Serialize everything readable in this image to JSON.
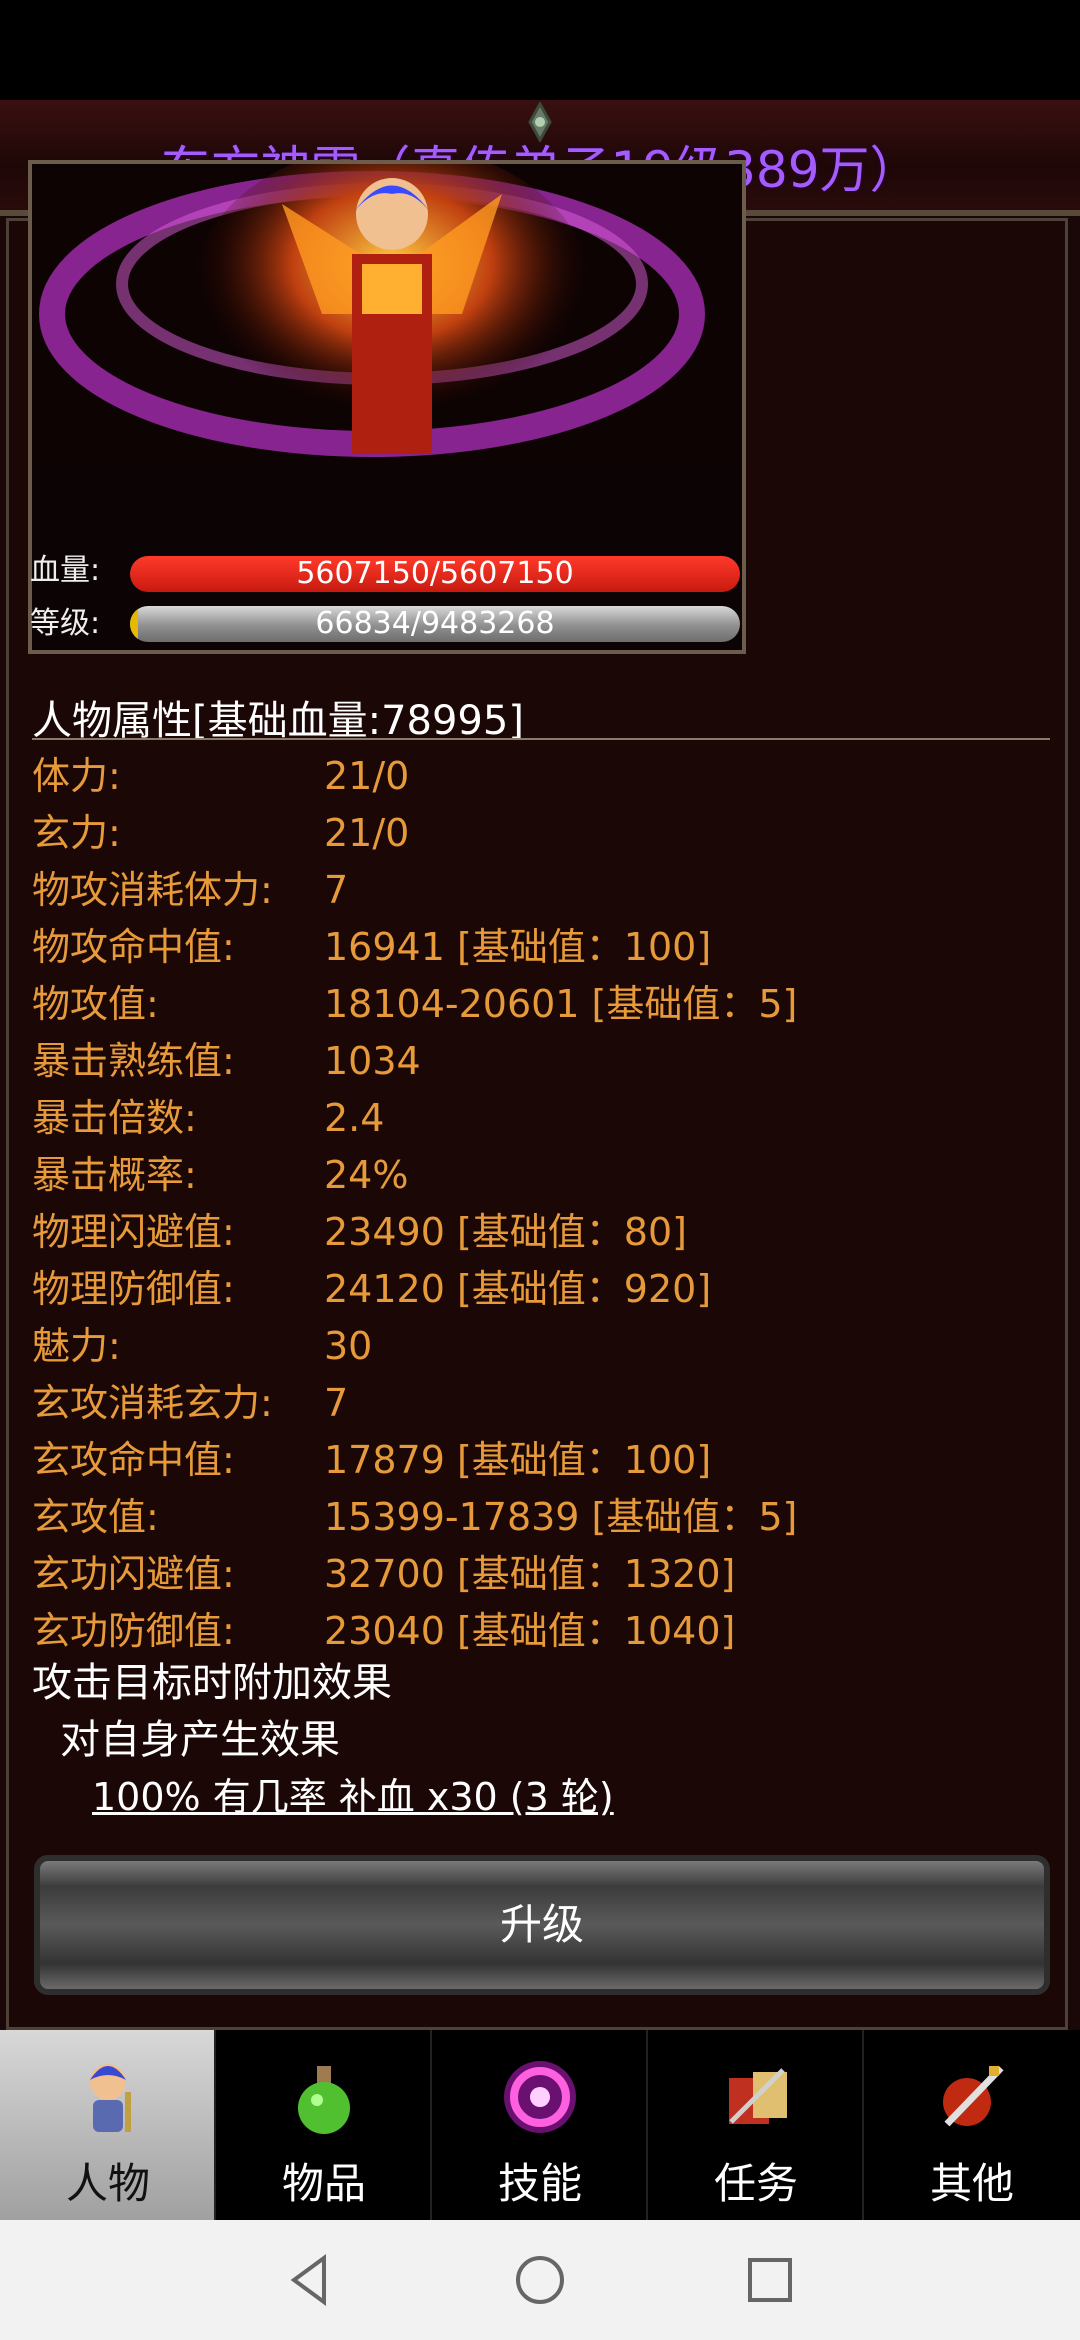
{
  "header": {
    "title": "东方神雪（真传弟子19级389万）"
  },
  "portrait": {
    "hp_label": "血量:",
    "hp_value": "5607150/5607150",
    "level_label": "等级:",
    "level_value": "66834/9483268",
    "xp_fraction": 0.007
  },
  "attributes": {
    "title": "人物属性[基础血量:78995]",
    "rows": [
      {
        "label": "体力:",
        "value": "21/0"
      },
      {
        "label": "玄力:",
        "value": "21/0"
      },
      {
        "label": "物攻消耗体力:",
        "value": "7"
      },
      {
        "label": "物攻命中值:",
        "value": "16941 [基础值：100]"
      },
      {
        "label": "物攻值:",
        "value": "18104-20601 [基础值：5]"
      },
      {
        "label": "暴击熟练值:",
        "value": "1034"
      },
      {
        "label": "暴击倍数:",
        "value": "2.4"
      },
      {
        "label": "暴击概率:",
        "value": "24%"
      },
      {
        "label": "物理闪避值:",
        "value": "23490 [基础值：80]"
      },
      {
        "label": "物理防御值:",
        "value": "24120 [基础值：920]"
      },
      {
        "label": "魅力:",
        "value": "30"
      },
      {
        "label": "玄攻消耗玄力:",
        "value": "7"
      },
      {
        "label": "玄攻命中值:",
        "value": "17879 [基础值：100]"
      },
      {
        "label": "玄攻值:",
        "value": "15399-17839 [基础值：5]"
      },
      {
        "label": "玄功闪避值:",
        "value": "32700 [基础值：1320]"
      },
      {
        "label": "玄功防御值:",
        "value": "23040 [基础值：1040]"
      }
    ]
  },
  "effects": {
    "heading": "攻击目标时附加效果",
    "self_heading": "对自身产生效果",
    "detail": "100% 有几率 补血 x30 (3 轮)"
  },
  "upgrade_button": "升级",
  "tabs": [
    {
      "label": "人物",
      "icon": "character-icon",
      "active": true
    },
    {
      "label": "物品",
      "icon": "potion-icon"
    },
    {
      "label": "技能",
      "icon": "skill-orb-icon"
    },
    {
      "label": "任务",
      "icon": "quest-scroll-icon"
    },
    {
      "label": "其他",
      "icon": "sword-shield-icon"
    }
  ],
  "colors": {
    "title": "#a55cff",
    "stat": "#e69a3a",
    "hp": "#e0201a"
  }
}
